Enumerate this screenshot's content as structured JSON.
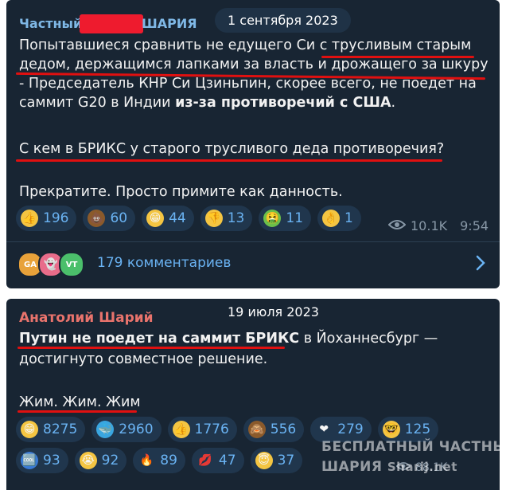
{
  "post1": {
    "sender_part1": "Частный",
    "sender_part2": "ШАРИЯ",
    "date": "1 сентября 2023",
    "lines": [
      "Попытавшиеся сравнить не едущего Си с трусливым старым",
      "дедом, держащимся лапками за власть и дрожащего за шкуру",
      "- Председатель КНР Си Цзиньпин, скорее всего, не поедет на",
      "саммит G20 в Индии",
      "из-за противоречий с США",
      ".",
      "С кем в БРИКС у старого трусливого деда противоречия?",
      "Прекратите. Просто примите как данность."
    ],
    "reactions": [
      {
        "emoji": "thumbs-up",
        "glyph": "👍",
        "count": "196"
      },
      {
        "emoji": "poop",
        "glyph": "💩",
        "count": "60"
      },
      {
        "emoji": "grin",
        "glyph": "😁",
        "count": "44"
      },
      {
        "emoji": "thumbs-down",
        "glyph": "👎",
        "count": "13"
      },
      {
        "emoji": "nauseated",
        "glyph": "🤮",
        "count": "11"
      },
      {
        "emoji": "ok-hand",
        "glyph": "👌",
        "count": "1"
      }
    ],
    "views": "10.1K",
    "time": "9:54",
    "avatars": [
      "GA",
      "",
      "VT"
    ],
    "comments": "179 комментариев"
  },
  "post2": {
    "sender": "Анатолий Шарий",
    "date": "19 июля 2023",
    "line1_bold": "Путин не поедет на саммит БРИКС",
    "line1_rest": " в Йоханнесбург —",
    "line2": "достигнуто совместное решение.",
    "line3": "Жим. Жим. Жим",
    "reactions_row1": [
      {
        "emoji": "grin",
        "glyph": "😁",
        "count": "8275"
      },
      {
        "emoji": "whale",
        "glyph": "🐳",
        "count": "2960"
      },
      {
        "emoji": "thumbs-up",
        "glyph": "👍",
        "count": "1776"
      },
      {
        "emoji": "see-no-evil",
        "glyph": "🙈",
        "count": "556"
      },
      {
        "emoji": "heart",
        "glyph": "❤",
        "count": "279"
      },
      {
        "emoji": "nerd",
        "glyph": "🤓",
        "count": "125"
      }
    ],
    "reactions_row2": [
      {
        "emoji": "cool",
        "glyph": "🆒",
        "count": "93"
      },
      {
        "emoji": "crying",
        "glyph": "😭",
        "count": "92"
      },
      {
        "emoji": "fire",
        "glyph": "🔥",
        "count": "89"
      },
      {
        "emoji": "kiss",
        "glyph": "💋",
        "count": "47"
      },
      {
        "emoji": "halo",
        "glyph": "😇",
        "count": "37"
      }
    ],
    "views_partial": "88.1K"
  },
  "watermark": {
    "line1": "БЕСПЛАТНЫЙ ЧАСТНЫЙ",
    "line2": "ШАРИЯ",
    "line2b": "Sharij.net"
  },
  "colors": {
    "bubble": "#182533",
    "link": "#6ab3f3",
    "sender1": "#7fb8e6",
    "sender2": "#e8736c",
    "underline": "#e01010"
  }
}
